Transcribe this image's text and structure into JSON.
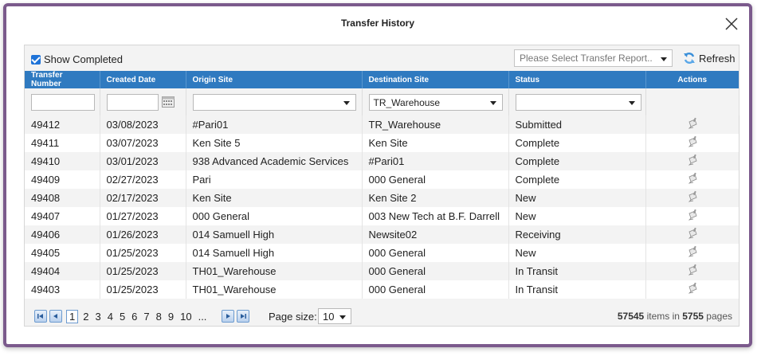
{
  "dialog": {
    "title": "Transfer History"
  },
  "toolbar": {
    "show_completed": "Show Completed",
    "report_placeholder": "Please Select Transfer Report..",
    "refresh": "Refresh"
  },
  "columns": [
    "Transfer Number",
    "Created Date",
    "Origin Site",
    "Destination Site",
    "Status",
    "Actions"
  ],
  "filters": {
    "destination": "TR_Warehouse"
  },
  "rows": [
    {
      "num": "49412",
      "date": "03/08/2023",
      "origin": "#Pari01",
      "dest": "TR_Warehouse",
      "status": "Submitted"
    },
    {
      "num": "49411",
      "date": "03/07/2023",
      "origin": "Ken Site 5",
      "dest": "Ken Site",
      "status": "Complete"
    },
    {
      "num": "49410",
      "date": "03/01/2023",
      "origin": "938 Advanced Academic Services",
      "dest": "#Pari01",
      "status": "Complete"
    },
    {
      "num": "49409",
      "date": "02/27/2023",
      "origin": "Pari",
      "dest": "000 General",
      "status": "Complete"
    },
    {
      "num": "49408",
      "date": "02/17/2023",
      "origin": "Ken Site",
      "dest": "Ken Site 2",
      "status": "New"
    },
    {
      "num": "49407",
      "date": "01/27/2023",
      "origin": "000 General",
      "dest": "003 New Tech at B.F. Darrell",
      "status": "New"
    },
    {
      "num": "49406",
      "date": "01/26/2023",
      "origin": "014 Samuell High",
      "dest": "Newsite02",
      "status": "Receiving"
    },
    {
      "num": "49405",
      "date": "01/25/2023",
      "origin": "014 Samuell High",
      "dest": "000 General",
      "status": "New"
    },
    {
      "num": "49404",
      "date": "01/25/2023",
      "origin": "TH01_Warehouse",
      "dest": "000 General",
      "status": "In Transit"
    },
    {
      "num": "49403",
      "date": "01/25/2023",
      "origin": "TH01_Warehouse",
      "dest": "000 General",
      "status": "In Transit"
    }
  ],
  "pager": {
    "current": "1",
    "pages": [
      "2",
      "3",
      "4",
      "5",
      "6",
      "7",
      "8",
      "9",
      "10",
      "..."
    ],
    "page_size_label": "Page size:",
    "page_size": "10",
    "items": "57545",
    "items_label": "items in",
    "page_count": "5755",
    "pages_label": "pages"
  },
  "colors": {
    "header": "#2f7ac0",
    "frame": "#7b5a8c"
  }
}
